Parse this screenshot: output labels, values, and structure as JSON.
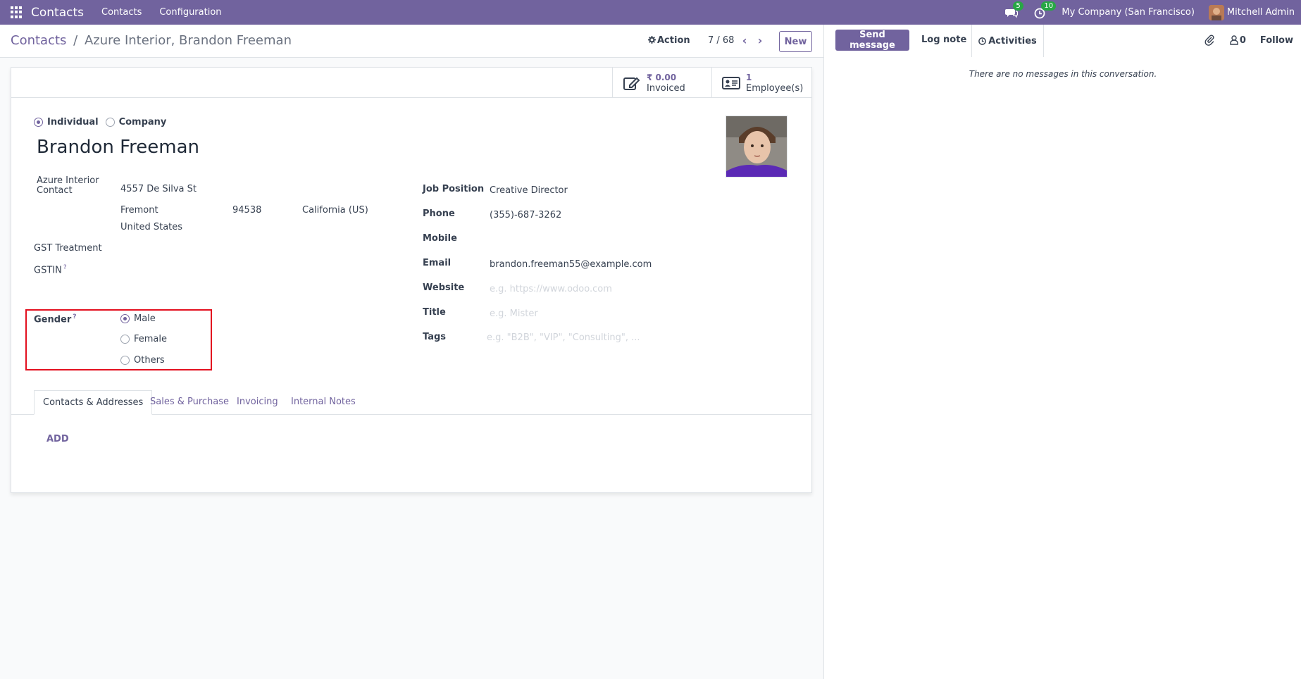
{
  "navbar": {
    "brand": "Contacts",
    "menu": [
      "Contacts",
      "Configuration"
    ],
    "messages_count": "5",
    "activities_count": "10",
    "company": "My Company (San Francisco)",
    "user": "Mitchell Admin"
  },
  "control": {
    "breadcrumb_root": "Contacts",
    "breadcrumb_sep": "/",
    "breadcrumb_current": "Azure Interior, Brandon Freeman",
    "action_label": "Action",
    "pager": "7 / 68",
    "new_label": "New"
  },
  "stats": {
    "invoiced_value": "₹ 0.00",
    "invoiced_label": "Invoiced",
    "employees_value": "1",
    "employees_label": "Employee(s)"
  },
  "form": {
    "type_individual": "Individual",
    "type_company": "Company",
    "name": "Brandon Freeman",
    "company_name": "Azure Interior",
    "contact_label": "Contact",
    "street": "4557 De Silva St",
    "city": "Fremont",
    "zip": "94538",
    "state": "California (US)",
    "country": "United States",
    "gst_treatment_label": "GST Treatment",
    "gstin_label": "GSTIN",
    "gender_label": "Gender",
    "gender_options": [
      "Male",
      "Female",
      "Others"
    ],
    "gender_selected": "Male",
    "help_mark": "?",
    "job_position_label": "Job Position",
    "job_position": "Creative Director",
    "phone_label": "Phone",
    "phone": "(355)-687-3262",
    "mobile_label": "Mobile",
    "email_label": "Email",
    "email": "brandon.freeman55@example.com",
    "website_label": "Website",
    "website_placeholder": "e.g. https://www.odoo.com",
    "title_label": "Title",
    "title_placeholder": "e.g. Mister",
    "tags_label": "Tags",
    "tags_placeholder": "e.g. \"B2B\", \"VIP\", \"Consulting\", ..."
  },
  "tabs": [
    "Contacts & Addresses",
    "Sales & Purchase",
    "Invoicing",
    "Internal Notes"
  ],
  "add_label": "ADD",
  "chatter": {
    "send_message": "Send message",
    "log_note": "Log note",
    "activities": "Activities",
    "followers_count": "0",
    "follow": "Follow",
    "empty_text": "There are no messages in this conversation."
  },
  "colors": {
    "brand": "#71639e",
    "highlight": "#e3101f",
    "badge": "#28a745"
  }
}
